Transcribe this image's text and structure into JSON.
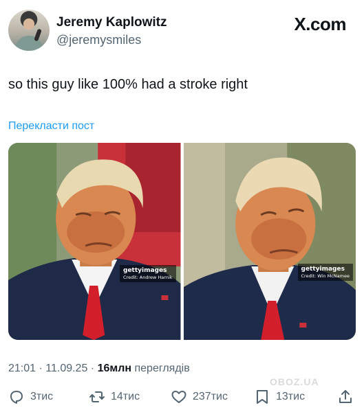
{
  "user": {
    "name": "Jeremy Kaplowitz",
    "handle": "@jeremysmiles"
  },
  "brand": {
    "label": "X.com"
  },
  "tweet": {
    "text": "so this guy like 100% had a stroke right",
    "translate_label": "Перекласти пост"
  },
  "photos": [
    {
      "credit_logo": "gettyimages",
      "credit": "Credit: Andrew Harnik"
    },
    {
      "credit_logo": "gettyimages",
      "credit": "Credit: Win McNamee"
    }
  ],
  "meta": {
    "time_date": "21:01 · 11.09.25 · ",
    "views_count": "16млн",
    "views_label": " переглядів"
  },
  "actions": {
    "replies": "3тис",
    "reposts": "14тис",
    "likes": "237тис",
    "bookmarks": "13тис"
  },
  "watermark": {
    "text": "OBOZ.UA"
  },
  "colors": {
    "link": "#1d9bf0",
    "secondary_text": "#536471",
    "primary_text": "#0f1419"
  },
  "icons": [
    "reply-icon",
    "repost-icon",
    "like-icon",
    "bookmark-icon",
    "share-icon"
  ]
}
